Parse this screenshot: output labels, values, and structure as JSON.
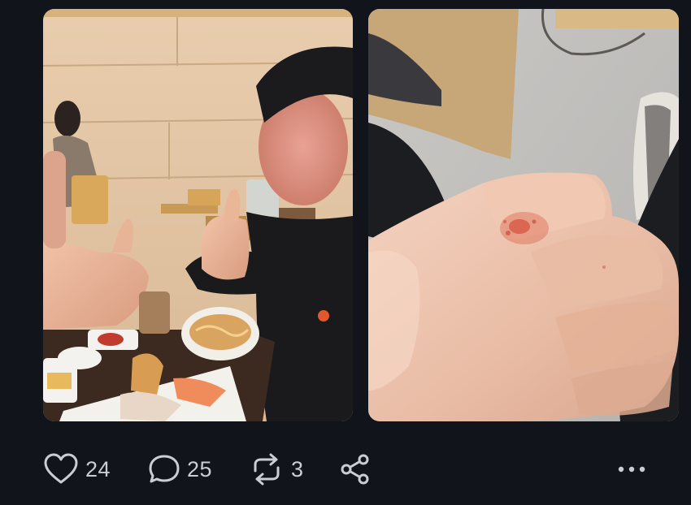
{
  "post": {
    "media": [
      {
        "kind": "photo",
        "subject": "restaurant-thumbs-up"
      },
      {
        "kind": "photo",
        "subject": "scraped-knuckle"
      }
    ],
    "actions": {
      "like_count": "24",
      "reply_count": "25",
      "repost_count": "3",
      "icons": {
        "like": "heart-icon",
        "reply": "speech-bubble-icon",
        "repost": "repost-arrows-icon",
        "share": "share-icon",
        "more": "more-dots-icon"
      }
    },
    "colors": {
      "background": "#11141a",
      "icon": "#c9cdd4"
    }
  }
}
